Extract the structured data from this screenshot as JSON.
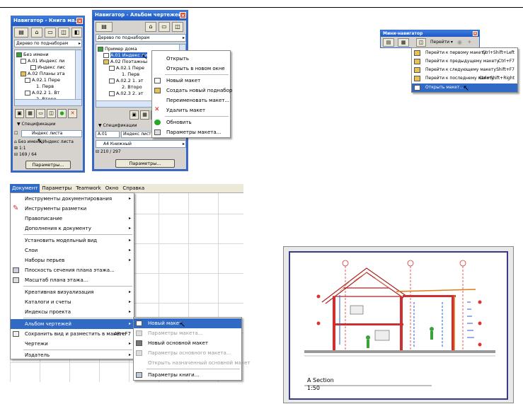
{
  "navigator_book": {
    "title": "Навигатор - Книга ма...",
    "view_mode": "Дерево по поднаборам",
    "tree": [
      {
        "label": "Без имени",
        "level": 0
      },
      {
        "label": "A.01 Индекс ли",
        "level": 1
      },
      {
        "label": "Индекс лис",
        "level": 2,
        "selected": true
      },
      {
        "label": "A.02 Планы эта",
        "level": 1
      },
      {
        "label": "A.02.1 Пере",
        "level": 2
      },
      {
        "label": "1. Перв",
        "level": 3
      },
      {
        "label": "A.02.2 1. Вт",
        "level": 2
      },
      {
        "label": "2. Второ",
        "level": 3
      }
    ],
    "spec_label": "Спецификации",
    "field_name": "Индекс листа",
    "path": "Без имени\\Индекс листа",
    "scale": "1:1",
    "size": "169 / 64",
    "params_button": "Параметры..."
  },
  "navigator_album": {
    "title": "Навигатор - Альбом чертежей",
    "view_mode": "Дерево по поднаборам",
    "tree": [
      {
        "label": "Пример дома",
        "level": 0
      },
      {
        "label": "A.01 Индекс ли",
        "level": 1,
        "selected": true
      },
      {
        "label": "A.02 Поэтажны",
        "level": 1
      },
      {
        "label": "A.02.1 Пере",
        "level": 2
      },
      {
        "label": "1. Перв",
        "level": 3
      },
      {
        "label": "A.02.2 1. эт",
        "level": 2
      },
      {
        "label": "2. Второ",
        "level": 3
      },
      {
        "label": "A.02.3 2. эт",
        "level": 2
      }
    ],
    "spec_label": "Спецификации",
    "field_id": "A.01",
    "field_name": "Индекс листов",
    "format": "A4 Книжный",
    "size": "210 / 297",
    "params_button": "Параметры..."
  },
  "context_menu": {
    "items": [
      {
        "label": "Открыть",
        "icon": "open-icon"
      },
      {
        "label": "Открыть в новом окне",
        "icon": "none"
      },
      {
        "label": "Новый макет",
        "icon": "new-layout-icon"
      },
      {
        "label": "Создать новый поднабор",
        "icon": "new-subset-icon"
      },
      {
        "label": "Переименовать макет...",
        "icon": "none"
      },
      {
        "label": "Удалить макет",
        "icon": "delete-icon"
      },
      {
        "label": "Обновить",
        "icon": "refresh-icon"
      },
      {
        "label": "Параметры макета...",
        "icon": "settings-icon"
      }
    ]
  },
  "mini_navigator": {
    "title": "Мини-навигатор",
    "go_label": "Перейти",
    "items": [
      {
        "label": "Перейти к первому макету",
        "shortcut": "Ctrl+Shift+Left"
      },
      {
        "label": "Перейти к предыдущему макету",
        "shortcut": "Ctrl+F7"
      },
      {
        "label": "Перейти к следующему макету",
        "shortcut": "Shift+F7"
      },
      {
        "label": "Перейти к последнему макету",
        "shortcut": "Ctrl+Shift+Right"
      },
      {
        "label": "Открыть макет...",
        "shortcut": ""
      }
    ]
  },
  "document_menu": {
    "menubar": [
      "Документ",
      "Параметры",
      "Teamwork",
      "Окно",
      "Справка"
    ],
    "items": [
      {
        "label": "Инструменты документирования",
        "submenu": true
      },
      {
        "label": "Инструменты разметки",
        "submenu": false
      },
      {
        "label": "Правописание",
        "submenu": true
      },
      {
        "label": "Дополнения к документу",
        "submenu": true
      },
      {
        "label": "Установить модельный вид",
        "submenu": true
      },
      {
        "label": "Слои",
        "submenu": true
      },
      {
        "label": "Наборы перьев",
        "submenu": true
      },
      {
        "label": "Плоскость сечения плана этажа...",
        "submenu": false
      },
      {
        "label": "Масштаб плана этажа...",
        "submenu": false
      },
      {
        "label": "Креативная визуализация",
        "submenu": true
      },
      {
        "label": "Каталоги и счеты",
        "submenu": true
      },
      {
        "label": "Индексы проекта",
        "submenu": true
      },
      {
        "label": "Альбом чертежей",
        "submenu": true
      },
      {
        "label": "Сохранить вид и разместить в макете",
        "shortcut": "Alt+F7"
      },
      {
        "label": "Чертежи",
        "submenu": true
      },
      {
        "label": "Издатель",
        "submenu": true
      }
    ],
    "album_submenu": [
      {
        "label": "Новый макет",
        "disabled": false
      },
      {
        "label": "Параметры макета...",
        "disabled": true
      },
      {
        "label": "Новый основной макет",
        "disabled": false
      },
      {
        "label": "Параметры основного макета...",
        "disabled": true
      },
      {
        "label": "Открыть назначенный основной макет",
        "disabled": true
      },
      {
        "label": "Параметры книги...",
        "disabled": false
      }
    ]
  },
  "layout_sheet": {
    "drawing_title": "A Section",
    "drawing_scale": "1:50"
  }
}
